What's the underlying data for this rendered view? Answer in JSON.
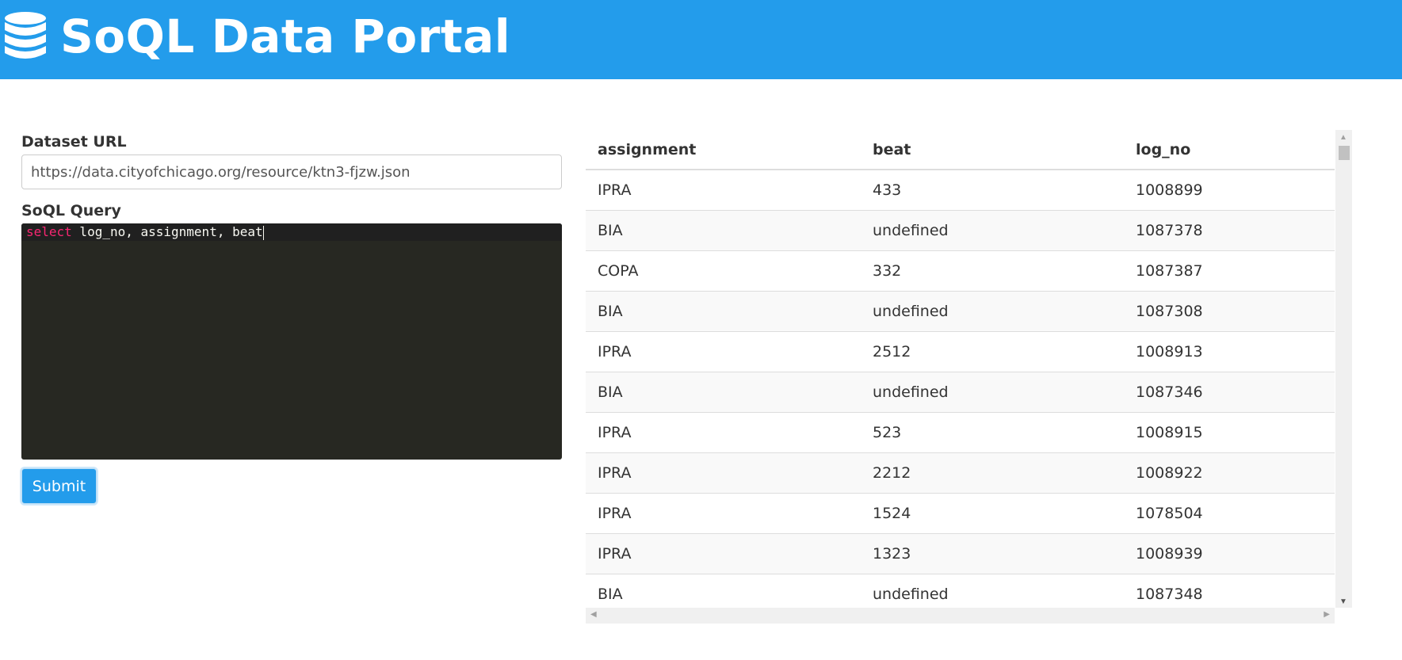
{
  "header": {
    "brand": "SoQL Data Portal",
    "icon": "database-icon",
    "bg_color": "#239ceb"
  },
  "form": {
    "dataset_label": "Dataset URL",
    "dataset_value": "https://data.cityofchicago.org/resource/ktn3-fjzw.json",
    "query_label": "SoQL Query",
    "query_keyword": "select",
    "query_rest": " log_no, assignment, beat",
    "submit_label": "Submit"
  },
  "table": {
    "columns": [
      "assignment",
      "beat",
      "log_no"
    ],
    "rows": [
      [
        "IPRA",
        "433",
        "1008899"
      ],
      [
        "BIA",
        "undefined",
        "1087378"
      ],
      [
        "COPA",
        "332",
        "1087387"
      ],
      [
        "BIA",
        "undefined",
        "1087308"
      ],
      [
        "IPRA",
        "2512",
        "1008913"
      ],
      [
        "BIA",
        "undefined",
        "1087346"
      ],
      [
        "IPRA",
        "523",
        "1008915"
      ],
      [
        "IPRA",
        "2212",
        "1008922"
      ],
      [
        "IPRA",
        "1524",
        "1078504"
      ],
      [
        "IPRA",
        "1323",
        "1008939"
      ],
      [
        "BIA",
        "undefined",
        "1087348"
      ]
    ]
  }
}
